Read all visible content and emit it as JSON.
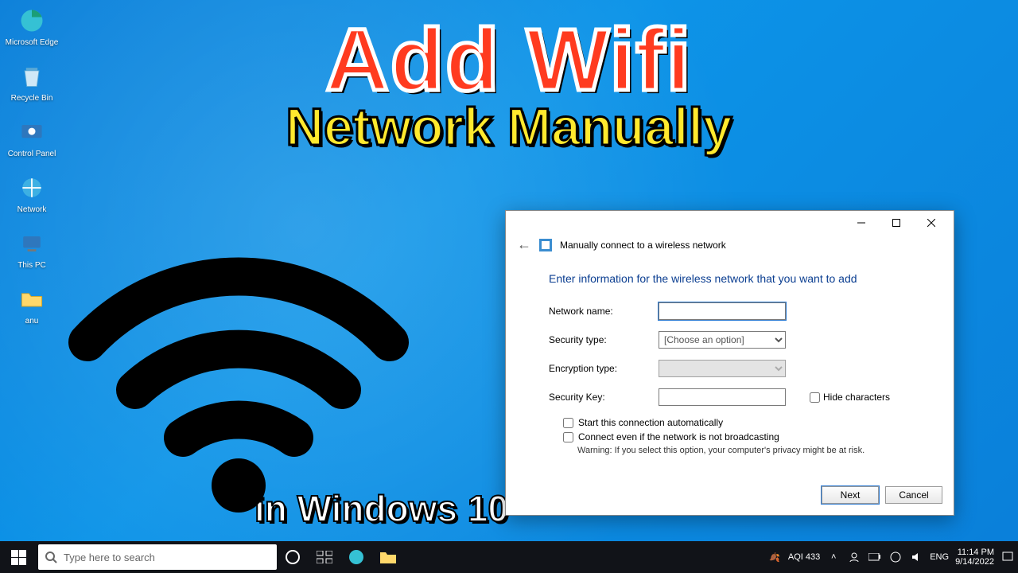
{
  "desktop_icons": [
    {
      "name": "edge",
      "label": "Microsoft Edge"
    },
    {
      "name": "recycle",
      "label": "Recycle Bin"
    },
    {
      "name": "cpl",
      "label": "Control Panel"
    },
    {
      "name": "net",
      "label": "Network"
    },
    {
      "name": "pc",
      "label": "This PC"
    },
    {
      "name": "anu",
      "label": "anu"
    }
  ],
  "overlay": {
    "line1": "Add Wifi",
    "line2": "Network Manually",
    "line3": "in Windows 10"
  },
  "dialog": {
    "title": "Manually connect to a wireless network",
    "heading": "Enter information for the wireless network that you want to add",
    "labels": {
      "network_name": "Network name:",
      "security_type": "Security type:",
      "encryption_type": "Encryption type:",
      "security_key": "Security Key:"
    },
    "security_placeholder": "[Choose an option]",
    "hide_characters": "Hide characters",
    "auto_start": "Start this connection automatically",
    "connect_hidden": "Connect even if the network is not broadcasting",
    "warning": "Warning: If you select this option, your computer's privacy might be at risk.",
    "buttons": {
      "next": "Next",
      "cancel": "Cancel"
    }
  },
  "taskbar": {
    "search_placeholder": "Type here to search",
    "aqi": "AQI 433",
    "lang": "ENG",
    "time": "11:14 PM",
    "date": "9/14/2022"
  }
}
